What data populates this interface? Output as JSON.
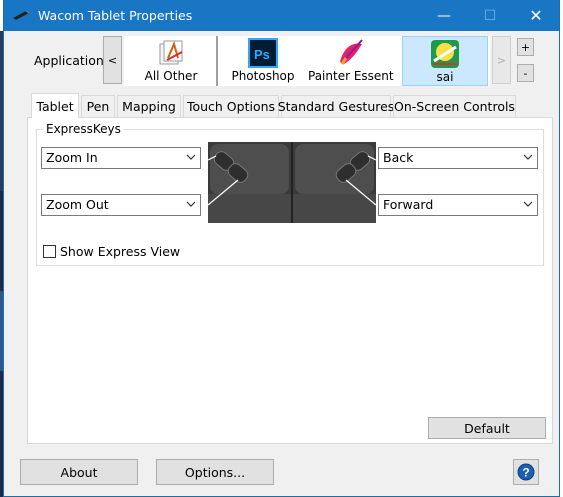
{
  "window": {
    "title": "Wacom Tablet Properties",
    "minimize_glyph": "—",
    "maximize_glyph": "☐",
    "close_glyph": "✕"
  },
  "application": {
    "label": "Application:",
    "scroll_left": "<",
    "scroll_right": ">",
    "add": "+",
    "remove": "-",
    "items": [
      {
        "label": "All Other",
        "icon": "all-other-icon"
      },
      {
        "label": "Photoshop",
        "icon": "photoshop-icon"
      },
      {
        "label": "Painter Essent...",
        "icon": "painter-icon"
      },
      {
        "label": "sai",
        "icon": "sai-icon"
      }
    ],
    "selected": "sai"
  },
  "tabs": [
    {
      "label": "Tablet",
      "active": true
    },
    {
      "label": "Pen",
      "active": false
    },
    {
      "label": "Mapping",
      "active": false
    },
    {
      "label": "Touch Options",
      "active": false
    },
    {
      "label": "Standard Gestures",
      "active": false
    },
    {
      "label": "On-Screen Controls",
      "active": false
    }
  ],
  "expresskeys": {
    "group_title": "ExpressKeys",
    "left_top": "Zoom In",
    "left_bottom": "Zoom Out",
    "right_top": "Back",
    "right_bottom": "Forward",
    "show_express_view_label": "Show Express View",
    "show_express_view_checked": false
  },
  "buttons": {
    "default": "Default",
    "about": "About",
    "options": "Options...",
    "help_glyph": "?"
  },
  "photoshop_icon_text": "Ps",
  "colors": {
    "titlebar": "#1976c4",
    "selection": "#cce8ff"
  }
}
